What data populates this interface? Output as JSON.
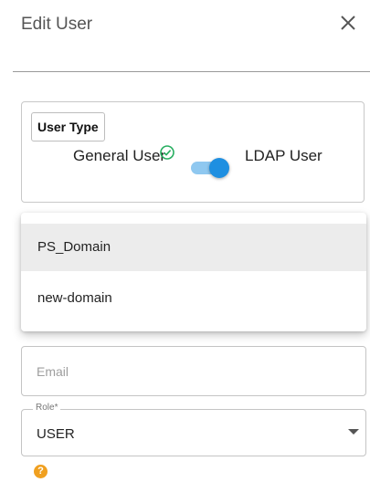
{
  "dialog": {
    "title": "Edit User",
    "close_icon": "close-icon"
  },
  "user_type": {
    "label": "User Type",
    "general_label": "General User",
    "general_status_icon": "check-circle-icon",
    "ldap_label": "LDAP User",
    "toggle_on": true
  },
  "domain_menu": {
    "items": [
      {
        "label": "PS_Domain",
        "selected": true
      },
      {
        "label": "new-domain",
        "selected": false
      }
    ]
  },
  "email": {
    "placeholder": "Email",
    "value": ""
  },
  "role": {
    "legend": "Role*",
    "value": "USER",
    "arrow_icon": "caret-down-icon"
  },
  "help": {
    "icon": "help-icon",
    "glyph": "?"
  },
  "colors": {
    "accent": "#1e8fe1",
    "check": "#27ae60",
    "help": "#f0a020"
  }
}
